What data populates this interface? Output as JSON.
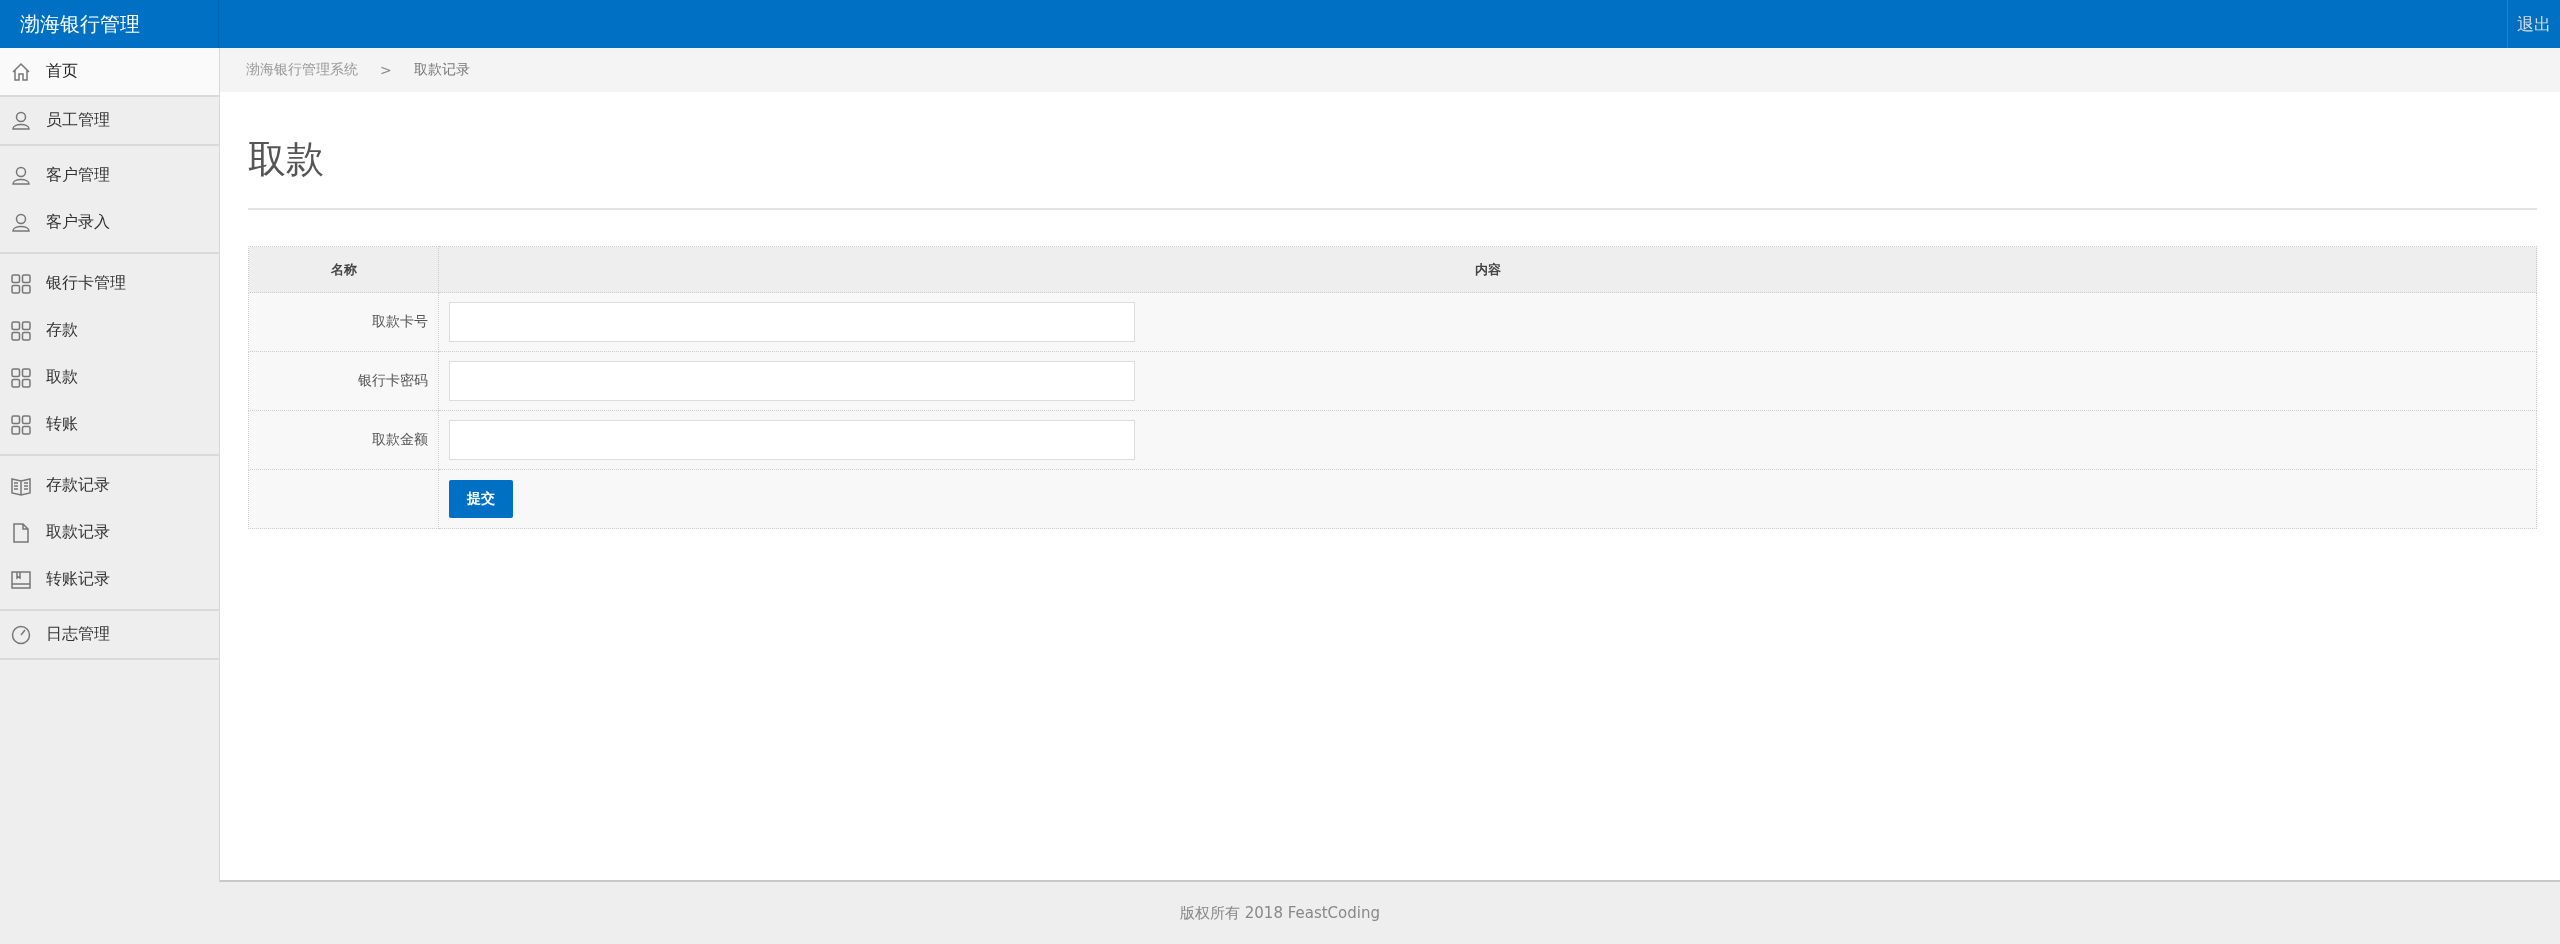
{
  "header": {
    "title": "渤海银行管理",
    "logout": "退出"
  },
  "sidebar": {
    "groups": [
      {
        "items": [
          {
            "label": "首页",
            "kind": "home",
            "selected": true
          }
        ]
      },
      {
        "items": [
          {
            "label": "员工管理",
            "kind": "user",
            "selected": false
          }
        ]
      },
      {
        "items": [
          {
            "label": "客户管理",
            "kind": "user",
            "selected": false
          },
          {
            "label": "客户录入",
            "kind": "user",
            "selected": false
          }
        ]
      },
      {
        "items": [
          {
            "label": "银行卡管理",
            "kind": "card",
            "selected": false
          },
          {
            "label": "存款",
            "kind": "card",
            "selected": false
          },
          {
            "label": "取款",
            "kind": "card",
            "selected": false
          },
          {
            "label": "转账",
            "kind": "card",
            "selected": false
          }
        ]
      },
      {
        "items": [
          {
            "label": "存款记录",
            "kind": "record",
            "selected": false
          },
          {
            "label": "取款记录",
            "kind": "document",
            "selected": false
          },
          {
            "label": "转账记录",
            "kind": "ledger",
            "selected": false
          }
        ]
      },
      {
        "items": [
          {
            "label": "日志管理",
            "kind": "log",
            "selected": false
          }
        ]
      }
    ]
  },
  "breadcrumb": {
    "items": [
      "渤海银行管理系统",
      "取款记录"
    ],
    "separator": ">"
  },
  "page_title": "取款",
  "form": {
    "columns": [
      "名称",
      "内容"
    ],
    "rows": [
      {
        "label": "取款卡号"
      },
      {
        "label": "银行卡密码"
      },
      {
        "label": "取款金额"
      }
    ],
    "submit": "提交"
  },
  "footer": "版权所有 2018 FeastCoding"
}
